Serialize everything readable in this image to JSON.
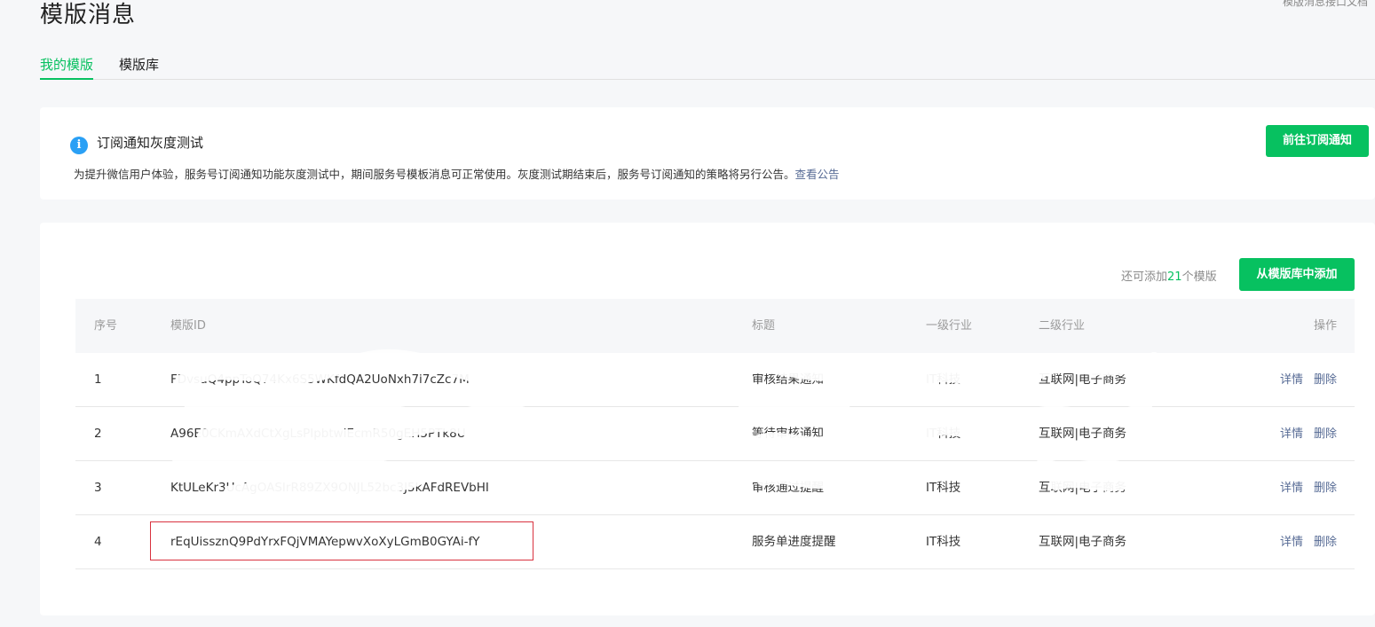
{
  "header": {
    "title": "模版消息",
    "doc_link": "模版消息接口文档"
  },
  "tabs": [
    {
      "label": "我的模版",
      "active": true
    },
    {
      "label": "模版库",
      "active": false
    }
  ],
  "notice": {
    "icon": "info-icon",
    "title": "订阅通知灰度测试",
    "description": "为提升微信用户体验，服务号订阅通知功能灰度测试中，期间服务号模板消息可正常使用。灰度测试期结束后，服务号订阅通知的策略将另行公告。",
    "link": "查看公告",
    "button": "前往订阅通知"
  },
  "panel": {
    "quota_prefix": "还可添加",
    "quota_count": "21",
    "quota_suffix": "个模版",
    "add_button": "从模版库中添加"
  },
  "table": {
    "headers": {
      "index": "序号",
      "template_id": "模版ID",
      "title": "标题",
      "industry_1": "一级行业",
      "industry_2": "二级行业",
      "actions": "操作"
    },
    "rows": [
      {
        "index": "1",
        "template_id": "FDvsuQ4ppToQ74Kx6S5WKfdQA2UoNxh7i7cZc7M",
        "title": "审核结果通知",
        "industry_1": "IT科技",
        "industry_2": "互联网|电子商务",
        "detail": "详情",
        "delete": "删除"
      },
      {
        "index": "2",
        "template_id": "A96E0CKmAXdCtXgLsPIpbtwiEcmR50gEH5PTk8U",
        "title": "等待审核通知",
        "industry_1": "IT科技",
        "industry_2": "互联网|电子商务",
        "detail": "详情",
        "delete": "删除"
      },
      {
        "index": "3",
        "template_id": "KtULeKr3UcAgOASIrR89ZX9ONJL52bc3J5kAFdREVbHI",
        "title": "审核通过提醒",
        "industry_1": "IT科技",
        "industry_2": "互联网|电子商务",
        "detail": "详情",
        "delete": "删除"
      },
      {
        "index": "4",
        "template_id": "rEqUissznQ9PdYrxFQjVMAYepwvXoXyLGmB0GYAi-fY",
        "title": "服务单进度提醒",
        "industry_1": "IT科技",
        "industry_2": "互联网|电子商务",
        "detail": "详情",
        "delete": "删除"
      }
    ]
  },
  "colors": {
    "accent": "#07c160",
    "link": "#576b95",
    "highlight": "#d9323f"
  }
}
